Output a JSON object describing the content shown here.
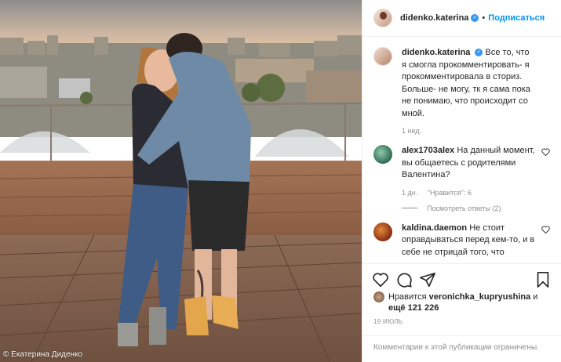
{
  "photo": {
    "credit": "© Екатерина Диденко"
  },
  "header": {
    "username": "didenko.katerina",
    "separator": "•",
    "follow_label": "Подписаться"
  },
  "caption": {
    "username": "didenko.katerina",
    "text": "Все то, что я смогла прокомментировать- я прокомментировала в сториз. Больше- не могу, тк я сама пока не понимаю, что происходит со мной.",
    "time": "1 нед."
  },
  "comments": [
    {
      "username": "alex1703alex",
      "text": "На данный момент, вы общаетесь с родителями Валентина?",
      "time": "1 дн.",
      "likes": "\"Нравится\": 6",
      "replies": "Посмотреть ответы (2)"
    },
    {
      "username": "kaldina.daemon",
      "text": "Не стоит оправдываться перед кем-то, и в себе не отрицай того, что"
    }
  ],
  "likes": {
    "prefix": "Нравится",
    "user": "veronichka_kupryushina",
    "middle": "и",
    "count": "ещё 121 226"
  },
  "post_date": "19 ИЮЛЬ",
  "comments_limited": "Комментарии к этой публикации ограничены.",
  "colors": {
    "accent": "#0095f6",
    "verified": "#3897f0",
    "muted": "#8e8e8e",
    "text": "#262626"
  },
  "icons": [
    "heart-icon",
    "comment-icon",
    "share-icon",
    "bookmark-icon",
    "verified-icon"
  ]
}
